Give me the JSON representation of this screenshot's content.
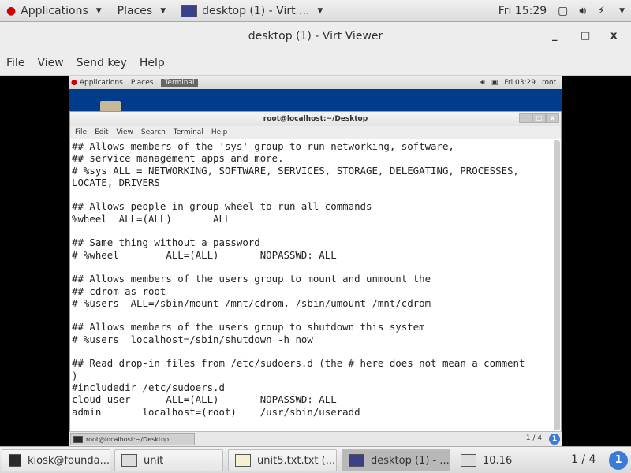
{
  "host_topbar": {
    "applications": "Applications",
    "places": "Places",
    "window": "desktop (1) - Virt ...",
    "clock": "Fri 15:29"
  },
  "window": {
    "title": "desktop (1) - Virt Viewer",
    "minimize": "_",
    "maximize": "□",
    "close": "x",
    "menu": [
      "File",
      "View",
      "Send key",
      "Help"
    ]
  },
  "vm_topbar": {
    "applications": "Applications",
    "places": "Places",
    "terminal": "Terminal",
    "clock": "Fri 03:29",
    "user": "root"
  },
  "terminal": {
    "title": "root@localhost:~/Desktop",
    "menu": [
      "File",
      "Edit",
      "View",
      "Search",
      "Terminal",
      "Help"
    ],
    "lines": [
      "## Allows members of the 'sys' group to run networking, software,",
      "## service management apps and more.",
      "# %sys ALL = NETWORKING, SOFTWARE, SERVICES, STORAGE, DELEGATING, PROCESSES,",
      "LOCATE, DRIVERS",
      "",
      "## Allows people in group wheel to run all commands",
      "%wheel  ALL=(ALL)       ALL",
      "",
      "## Same thing without a password",
      "# %wheel        ALL=(ALL)       NOPASSWD: ALL",
      "",
      "## Allows members of the users group to mount and unmount the",
      "## cdrom as root",
      "# %users  ALL=/sbin/mount /mnt/cdrom, /sbin/umount /mnt/cdrom",
      "",
      "## Allows members of the users group to shutdown this system",
      "# %users  localhost=/sbin/shutdown -h now",
      "",
      "## Read drop-in files from /etc/sudoers.d (the # here does not mean a comment",
      ")",
      "#includedir /etc/sudoers.d",
      "cloud-user      ALL=(ALL)       NOPASSWD: ALL",
      "admin       localhost=(root)    /usr/sbin/useradd"
    ]
  },
  "vm_taskbar": {
    "task": "root@localhost:~/Desktop",
    "pages": "1 / 4",
    "badge": "1"
  },
  "host_taskbar": {
    "tasks": [
      "kiosk@founda...",
      "unit",
      "unit5.txt.txt (...",
      "desktop (1) - ...",
      "10.16"
    ],
    "pages": "1 / 4",
    "badge": "1"
  }
}
